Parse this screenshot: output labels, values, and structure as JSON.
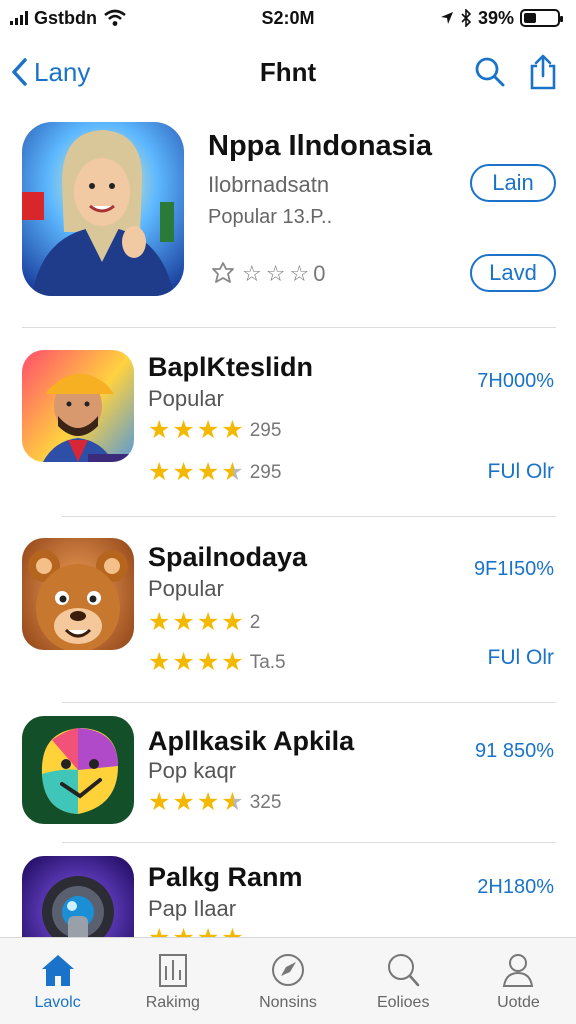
{
  "status_bar": {
    "carrier": "Gstbdn",
    "time": "S2:0M",
    "battery_pct": "39%",
    "battery_level": 0.39
  },
  "nav": {
    "back_label": "Lany",
    "title": "Fhnt",
    "search_icon": "search-icon",
    "share_icon": "share-icon"
  },
  "featured": {
    "title": "Nppa Ilndonasia",
    "subtitle": "Ilobrnadsatn",
    "subtitle2": "Popular 13.P..",
    "rating_text": "0",
    "button_top": "Lain",
    "button_bottom": "Lavd"
  },
  "apps": [
    {
      "name": "BaplKteslidn",
      "category": "Popular",
      "rating_a": 4,
      "count_a": "295",
      "rating_b": 3.5,
      "count_b": "295",
      "price": "7H000%",
      "action": "FUl Olr",
      "icon": "person-cap-icon"
    },
    {
      "name": "Spailnodaya",
      "category": "Popular",
      "rating_a": 4,
      "count_a": "2",
      "rating_b": 4,
      "count_b": "Ta.5",
      "price": "9F1I50%",
      "action": "FUl Olr",
      "icon": "bear-icon"
    },
    {
      "name": "Apllkasik Apkila",
      "category": "Pop kaqr",
      "rating_a": 3.5,
      "count_a": "325",
      "price": "91 850%",
      "icon": "colorful-face-icon"
    },
    {
      "name": "Palkg Ranm",
      "category": "Pap Ilaar",
      "rating_a": 4,
      "price": "2H180%",
      "icon": "camera-lens-icon"
    }
  ],
  "tabs": [
    {
      "label": "Lavolc",
      "icon": "home-icon",
      "active": true
    },
    {
      "label": "Rakimg",
      "icon": "document-icon",
      "active": false
    },
    {
      "label": "Nonsins",
      "icon": "compass-icon",
      "active": false
    },
    {
      "label": "Eolioes",
      "icon": "search-icon",
      "active": false
    },
    {
      "label": "Uotde",
      "icon": "person-icon",
      "active": false
    }
  ],
  "colors": {
    "accent": "#1a73c9",
    "star": "#f5b800"
  }
}
